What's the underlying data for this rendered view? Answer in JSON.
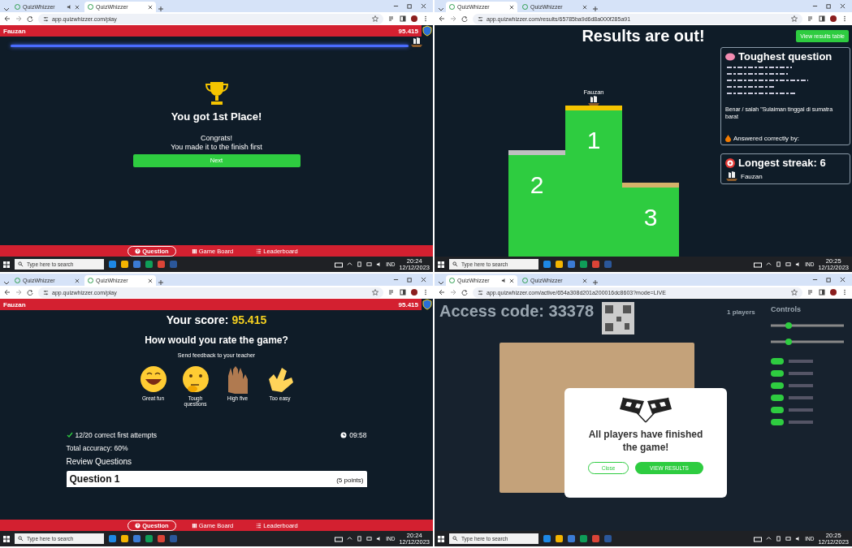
{
  "screens": [
    {
      "kind": "win",
      "tabs": [
        {
          "title": "QuizWhizzer",
          "selected": false,
          "audio": true
        },
        {
          "title": "QuizWhizzer",
          "selected": true,
          "audio": false
        }
      ],
      "url": "app.quizwhizzer.com/play",
      "player": "Fauzan",
      "score": "95.415",
      "progress": {
        "level": 1
      },
      "title": "You got 1st Place!",
      "message": "Congrats!",
      "detail": "You made it to the finish first",
      "button": "Next",
      "nav": [
        {
          "label": "Question",
          "selected": true
        },
        {
          "label": "Game Board",
          "selected": false
        },
        {
          "label": "Leaderboard",
          "selected": false
        }
      ],
      "taskbar": {
        "search_placeholder": "Type here to search",
        "language": "IND",
        "time": "20:24",
        "date": "12/12/2023"
      }
    },
    {
      "kind": "results",
      "tabs": [
        {
          "title": "QuizWhizzer",
          "selected": true,
          "audio": false
        },
        {
          "title": "QuizWhizzer",
          "selected": false,
          "audio": false
        }
      ],
      "url": "app.quizwhizzer.com/results/65785ba9d6d8a000f285a91",
      "title": "Results are out!",
      "button": "View results table",
      "podium": [
        {
          "place": "2"
        },
        {
          "place": "1",
          "player": "Fauzan"
        },
        {
          "place": "3"
        }
      ],
      "toughest": {
        "title": "Toughest question",
        "question": "Benar / salah \"Sulaiman tinggal di sumatra barat",
        "answered_label": "Answered correctly by:"
      },
      "streak": {
        "title": "Longest streak: 6",
        "player": "Fauzan"
      },
      "taskbar": {
        "search_placeholder": "Type here to search",
        "language": "IND",
        "time": "20:25",
        "date": "12/12/2023"
      }
    },
    {
      "kind": "score",
      "tabs": [
        {
          "title": "QuizWhizzer",
          "selected": false,
          "audio": false
        },
        {
          "title": "QuizWhizzer",
          "selected": true,
          "audio": false
        }
      ],
      "url": "app.quizwhizzer.com/play",
      "player": "Fauzan",
      "score": "95.415",
      "score_label": "Your score:",
      "score_value": "95.415",
      "question": "How would you rate the game?",
      "subtitle": "Send feedback to your teacher",
      "ratings": [
        {
          "label": "Great fun"
        },
        {
          "label": "Tough questions"
        },
        {
          "label": "High five"
        },
        {
          "label": "Too easy"
        }
      ],
      "attempts": "12/20 correct first attempts",
      "time_spent": "09:58",
      "accuracy": "Total accuracy: 60%",
      "review_title": "Review Questions",
      "review_card": {
        "title": "Question 1",
        "points": "(5 points)"
      },
      "nav": [
        {
          "label": "Question",
          "selected": true
        },
        {
          "label": "Game Board",
          "selected": false
        },
        {
          "label": "Leaderboard",
          "selected": false
        }
      ],
      "taskbar": {
        "search_placeholder": "Type here to search",
        "language": "IND",
        "time": "20:24",
        "date": "12/12/2023"
      }
    },
    {
      "kind": "finished",
      "tabs": [
        {
          "title": "QuizWhizzer",
          "selected": true,
          "audio": true
        },
        {
          "title": "QuizWhizzer",
          "selected": false,
          "audio": false
        }
      ],
      "url": "app.quizwhizzer.com/active/654a308d201a200016dc8603?mode=LIVE",
      "access_code": "Access code: 33378",
      "players": "1 players",
      "controls_title": "Controls",
      "modal": {
        "message": "All players have finished the game!",
        "close": "Close",
        "view": "VIEW RESULTS"
      },
      "taskbar": {
        "search_placeholder": "Type here to search",
        "language": "IND",
        "time": "20:25",
        "date": "12/12/2023"
      }
    }
  ]
}
